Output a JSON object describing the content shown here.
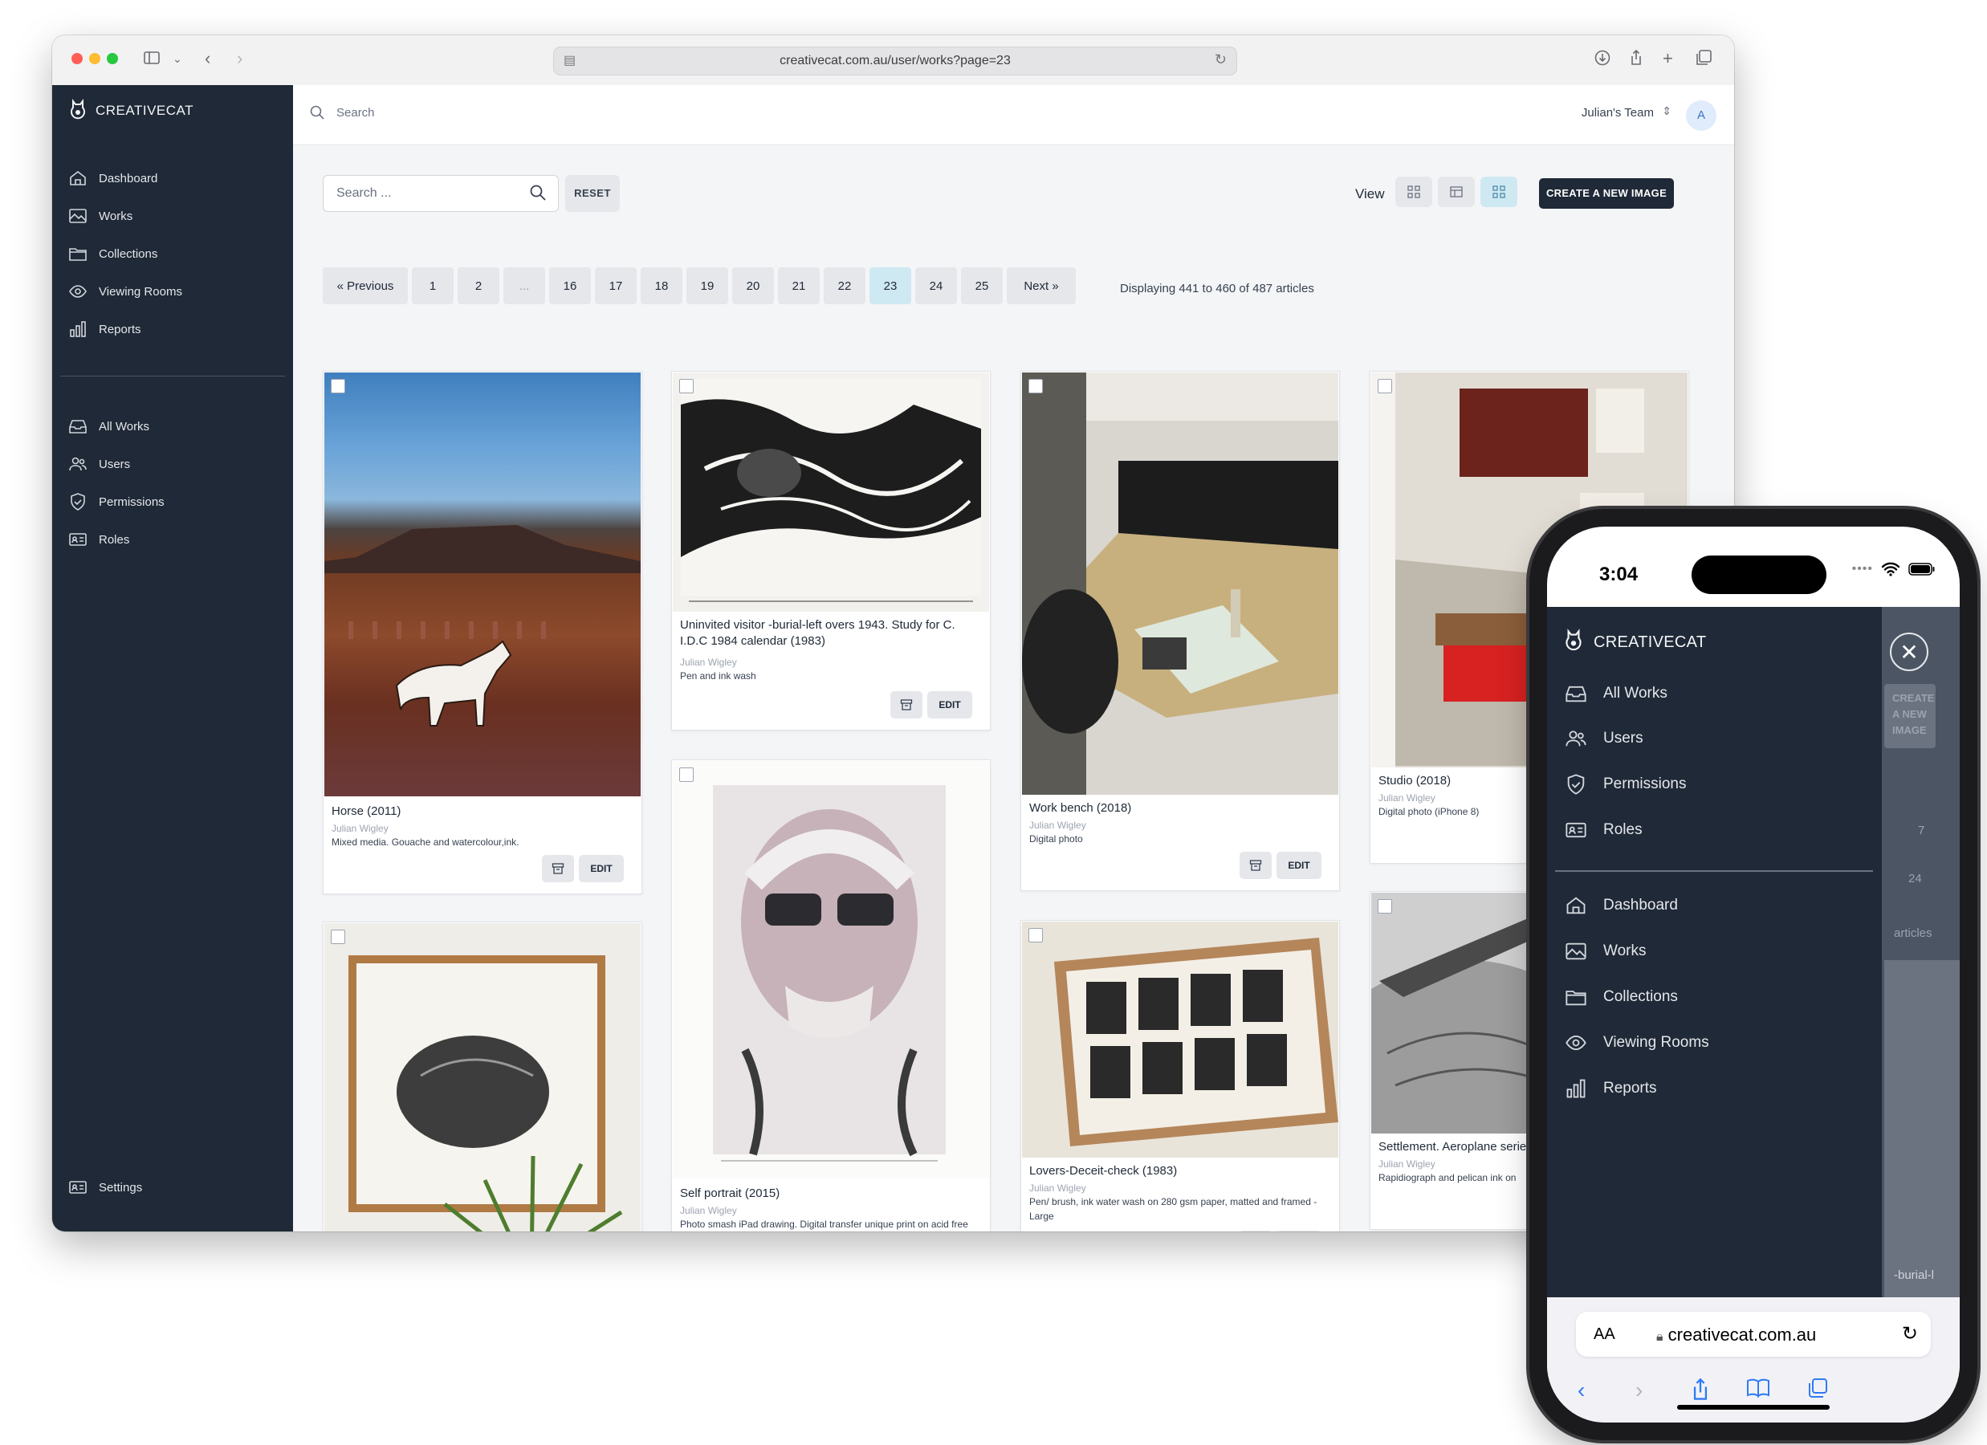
{
  "browser": {
    "url": "creativecat.com.au/user/works?page=23"
  },
  "brand": {
    "name": "CREATIVECAT"
  },
  "sidebar": {
    "primary": [
      "Dashboard",
      "Works",
      "Collections",
      "Viewing Rooms",
      "Reports"
    ],
    "admin": [
      "All Works",
      "Users",
      "Permissions",
      "Roles"
    ],
    "settings": "Settings"
  },
  "topbar": {
    "search_placeholder": "Search",
    "team": "Julian's Team",
    "avatar": "A"
  },
  "toolbar": {
    "search_placeholder": "Search ...",
    "reset": "RESET",
    "view_label": "View",
    "create": "CREATE A NEW IMAGE"
  },
  "pagination": {
    "previous": "« Previous",
    "next": "Next »",
    "pages": [
      "1",
      "2",
      "...",
      "16",
      "17",
      "18",
      "19",
      "20",
      "21",
      "22",
      "23",
      "24",
      "25"
    ],
    "active": "23",
    "info": "Displaying 441 to 460 of 487 articles"
  },
  "works": [
    {
      "title": "Horse (2011)",
      "artist": "Julian Wigley",
      "medium": "Mixed media. Gouache and watercolour,ink."
    },
    {
      "title": "Uninvited visitor -burial-left overs 1943. Study for C. I.D.C 1984 calendar (1983)",
      "artist": "Julian Wigley",
      "medium": "Pen and ink wash"
    },
    {
      "title": "Work bench (2018)",
      "artist": "Julian Wigley",
      "medium": "Digital photo"
    },
    {
      "title": "Studio (2018)",
      "artist": "Julian Wigley",
      "medium": "Digital photo (iPhone 8)"
    },
    {
      "title": "Self portrait (2015)",
      "artist": "Julian Wigley",
      "medium": "Photo smash iPad drawing. Digital transfer unique print on acid free card"
    },
    {
      "title": "Lovers-Deceit-check (1983)",
      "artist": "Julian Wigley",
      "medium": "Pen/ brush, ink water wash on 280 gsm paper, matted and framed -Large"
    },
    {
      "title": "Settlement. Aeroplane serie",
      "artist": "Julian Wigley",
      "medium": "Rapidiograph and pelican ink on"
    }
  ],
  "card_buttons": {
    "edit": "EDIT"
  },
  "phone": {
    "time": "3:04",
    "menu_admin": [
      "All Works",
      "Users",
      "Permissions",
      "Roles"
    ],
    "menu_primary": [
      "Dashboard",
      "Works",
      "Collections",
      "Viewing Rooms",
      "Reports"
    ],
    "behind_create": "CREATE\nA NEW\nIMAGE",
    "behind_texts": [
      "7",
      "24",
      "articles",
      "-burial-l"
    ],
    "safari_aa": "AA",
    "safari_domain": "creativecat.com.au"
  }
}
